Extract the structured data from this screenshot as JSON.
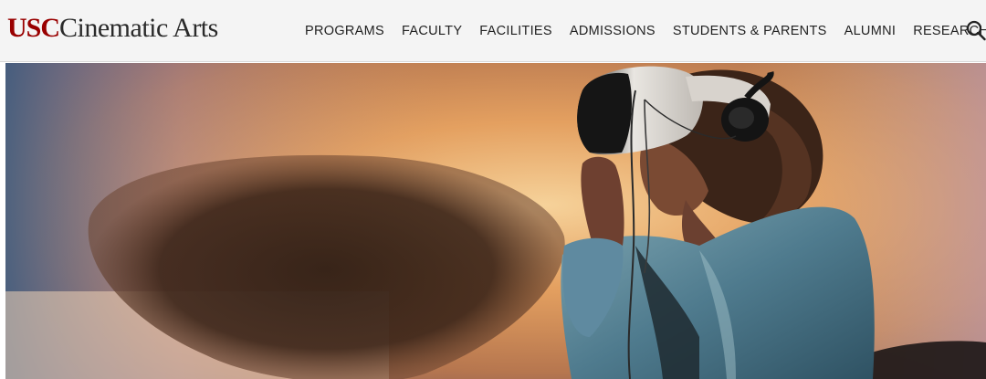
{
  "brand": {
    "usc": "USC",
    "name": "Cinematic Arts",
    "usc_color": "#990000"
  },
  "nav": {
    "items": [
      {
        "label": "PROGRAMS"
      },
      {
        "label": "FACULTY"
      },
      {
        "label": "FACILITIES"
      },
      {
        "label": "ADMISSIONS"
      },
      {
        "label": "STUDENTS & PARENTS"
      },
      {
        "label": "ALUMNI"
      },
      {
        "label": "RESEARCH"
      }
    ],
    "search_icon": "search-icon"
  },
  "hero": {
    "description_icon": "vr-headset-image"
  }
}
